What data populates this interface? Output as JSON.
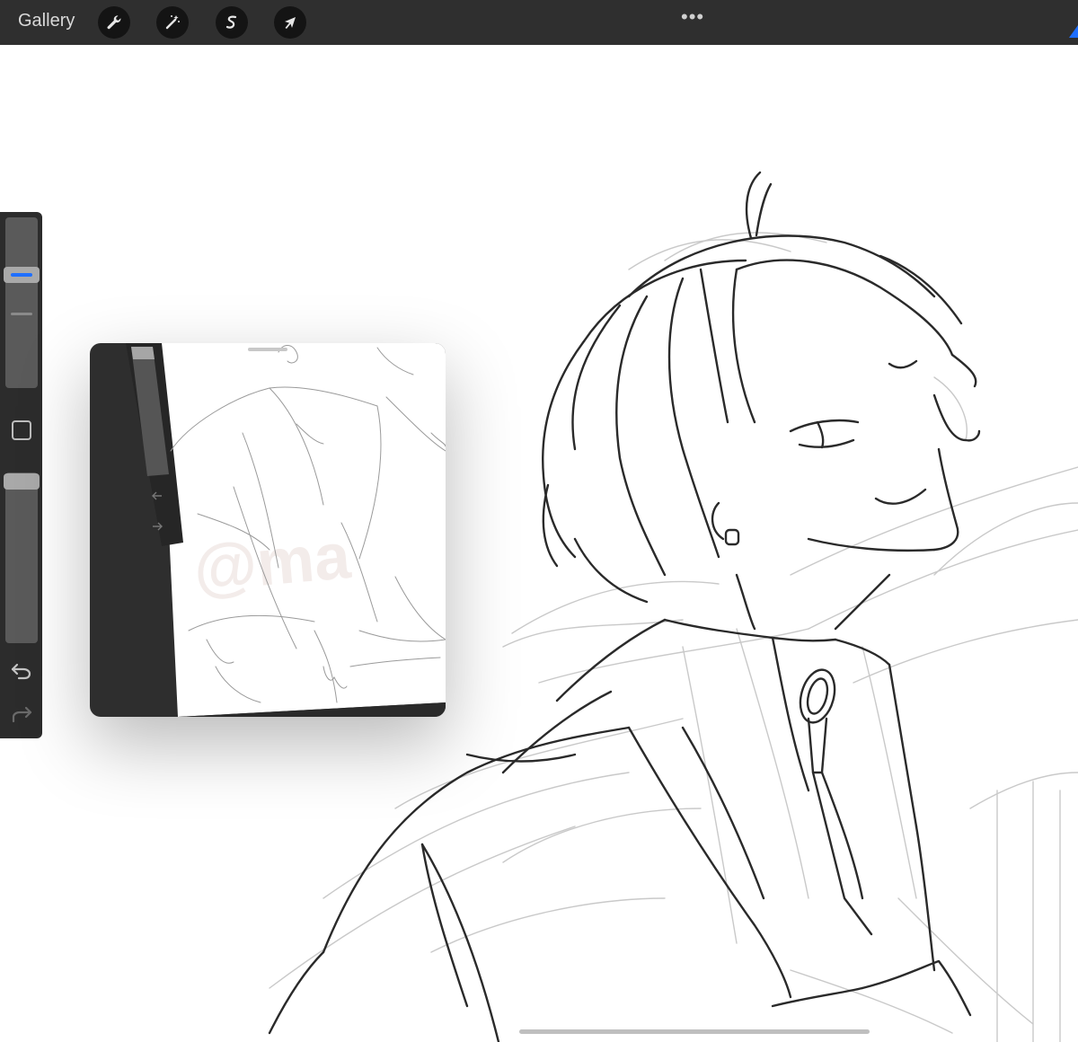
{
  "app": {
    "gallery_label": "Gallery",
    "accent_color": "#1f6fff",
    "toolbar_background": "#2f2f2f"
  },
  "toolbar": {
    "tools": [
      {
        "name": "actions",
        "icon": "wrench-icon"
      },
      {
        "name": "adjustments",
        "icon": "magic-wand-icon"
      },
      {
        "name": "selection",
        "icon": "selection-s-icon"
      },
      {
        "name": "transform",
        "icon": "arrow-cursor-icon"
      }
    ],
    "more_label": "•••"
  },
  "sidebar": {
    "brush_size_level": 0.38,
    "opacity_level": 0.05,
    "undo_icon": "undo-arrow-icon",
    "redo_icon": "redo-arrow-icon",
    "modify_icon": "square-modify-icon"
  },
  "reference_window": {
    "watermark": "@ma"
  }
}
